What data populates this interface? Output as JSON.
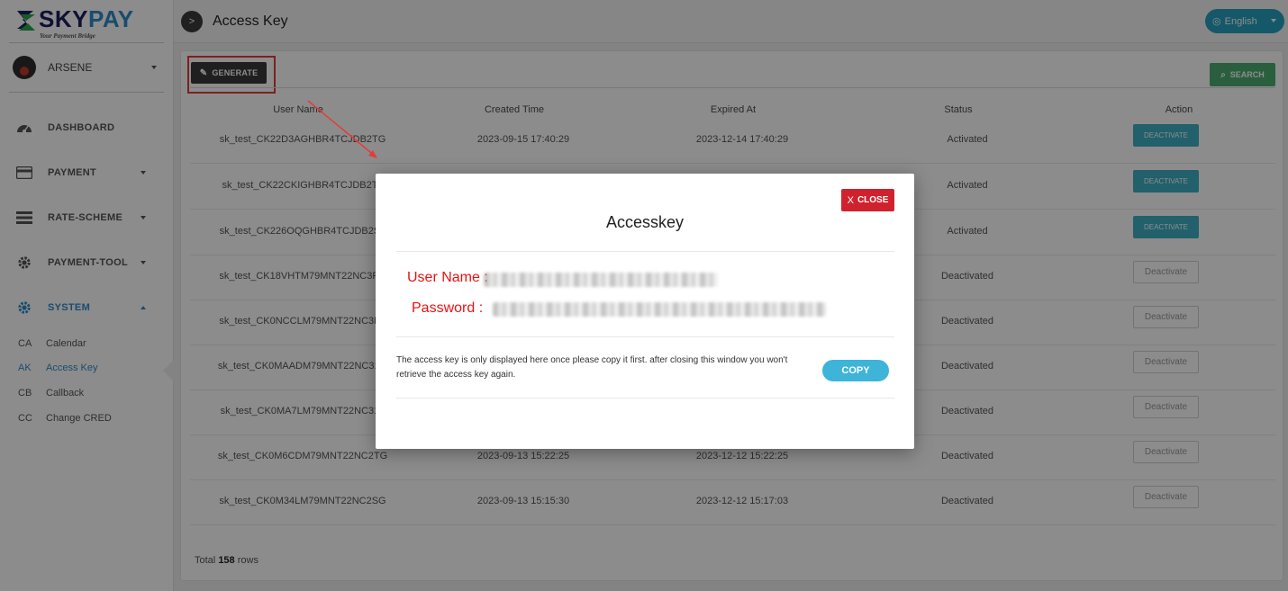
{
  "brand": {
    "name_part1": "SKY",
    "name_part2": "PAY",
    "tagline": "Your Payment Bridge"
  },
  "user": {
    "name": "ARSENE"
  },
  "sidebar": {
    "items": [
      {
        "label": "DASHBOARD",
        "icon": "dashboard-icon"
      },
      {
        "label": "PAYMENT",
        "icon": "credit-card-icon"
      },
      {
        "label": "RATE-SCHEME",
        "icon": "list-icon"
      },
      {
        "label": "PAYMENT-TOOL",
        "icon": "gear-icon"
      },
      {
        "label": "SYSTEM",
        "icon": "gear-icon"
      }
    ],
    "sub_items": [
      {
        "abbr": "CA",
        "label": "Calendar"
      },
      {
        "abbr": "AK",
        "label": "Access Key"
      },
      {
        "abbr": "CB",
        "label": "Callback"
      },
      {
        "abbr": "CC",
        "label": "Change CRED"
      }
    ]
  },
  "header": {
    "title": "Access Key",
    "back": ">",
    "language": "English"
  },
  "toolbar": {
    "generate": "GENERATE",
    "search": "SEARCH"
  },
  "table": {
    "columns": [
      "User Name",
      "Created Time",
      "Expired At",
      "Status",
      "Action"
    ],
    "rows": [
      {
        "user": "sk_test_CK22D3AGHBR4TCJDB2TG",
        "created": "2023-09-15 17:40:29",
        "expired": "2023-12-14 17:40:29",
        "status": "Activated",
        "action": "DEACTIVATE"
      },
      {
        "user": "sk_test_CK22CKIGHBR4TCJDB2T0",
        "created": "",
        "expired": "",
        "status": "Activated",
        "action": "DEACTIVATE"
      },
      {
        "user": "sk_test_CK226OQGHBR4TCJDB2S0",
        "created": "",
        "expired": "",
        "status": "Activated",
        "action": "DEACTIVATE"
      },
      {
        "user": "sk_test_CK18VHTM79MNT22NC3FG",
        "created": "",
        "expired": "",
        "status": "Deactivated",
        "action": "Deactivate"
      },
      {
        "user": "sk_test_CK0NCCLM79MNT22NC3B0",
        "created": "",
        "expired": "",
        "status": "Deactivated",
        "action": "Deactivate"
      },
      {
        "user": "sk_test_CK0MAADM79MNT22NC31G",
        "created": "",
        "expired": "",
        "status": "Deactivated",
        "action": "Deactivate"
      },
      {
        "user": "sk_test_CK0MA7LM79MNT22NC310",
        "created": "",
        "expired": "",
        "status": "Deactivated",
        "action": "Deactivate"
      },
      {
        "user": "sk_test_CK0M6CDM79MNT22NC2TG",
        "created": "2023-09-13 15:22:25",
        "expired": "2023-12-12 15:22:25",
        "status": "Deactivated",
        "action": "Deactivate"
      },
      {
        "user": "sk_test_CK0M34LM79MNT22NC2SG",
        "created": "2023-09-13 15:15:30",
        "expired": "2023-12-12 15:17:03",
        "status": "Deactivated",
        "action": "Deactivate"
      }
    ],
    "total_prefix": "Total",
    "total": "158",
    "total_suffix": "rows"
  },
  "modal": {
    "title": "Accesskey",
    "close": "CLOSE",
    "close_x": "X",
    "user_label": "User Name :",
    "password_label": "Password :",
    "note": "The access key is only displayed here once please copy it first. after closing this window you won't retrieve the access key again.",
    "copy": "COPY"
  },
  "colors": {
    "accent": "#2f8bc9",
    "close": "#d0222e",
    "copy": "#3db4d8",
    "search": "#4cae70",
    "highlight": "#e43b3b"
  }
}
